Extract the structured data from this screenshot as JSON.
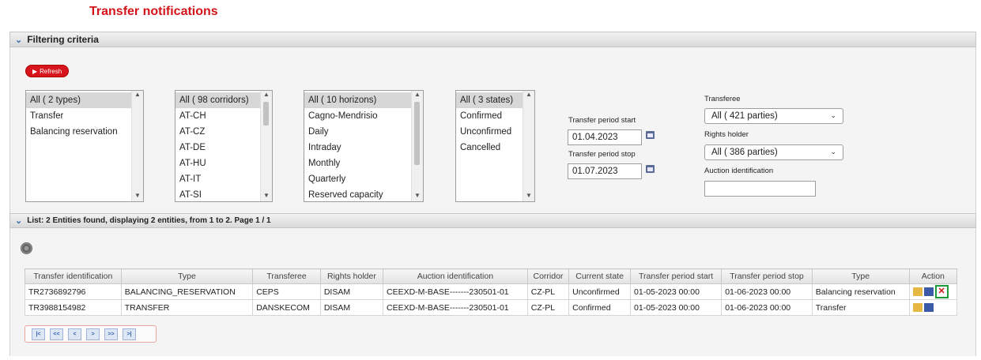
{
  "page_title": "Transfer notifications",
  "filtering": {
    "header": "Filtering criteria",
    "refresh_label": "Refresh",
    "types": [
      "All ( 2 types)",
      "Transfer",
      "Balancing reservation"
    ],
    "corridors": [
      "All ( 98 corridors)",
      "AT-CH",
      "AT-CZ",
      "AT-DE",
      "AT-HU",
      "AT-IT",
      "AT-SI"
    ],
    "horizons": [
      "All ( 10 horizons)",
      "Cagno-Mendrisio",
      "Daily",
      "Intraday",
      "Monthly",
      "Quarterly",
      "Reserved capacity"
    ],
    "states": [
      "All ( 3 states)",
      "Confirmed",
      "Unconfirmed",
      "Cancelled"
    ],
    "period_start_label": "Transfer period start",
    "period_start_value": "01.04.2023",
    "period_stop_label": "Transfer period stop",
    "period_stop_value": "01.07.2023",
    "transferee_label": "Transferee",
    "transferee_value": "All ( 421 parties)",
    "rights_holder_label": "Rights holder",
    "rights_holder_value": "All ( 386 parties)",
    "auction_label": "Auction identification",
    "auction_value": ""
  },
  "list": {
    "header": "List: 2 Entities found, displaying 2 entities, from 1 to 2. Page 1 / 1",
    "columns": [
      "Transfer identification",
      "Type",
      "Transferee",
      "Rights holder",
      "Auction identification",
      "Corridor",
      "Current state",
      "Transfer period start",
      "Transfer period stop",
      "Type",
      "Action"
    ],
    "rows": [
      [
        "TR2736892796",
        "BALANCING_RESERVATION",
        "CEPS",
        "DISAM",
        "CEEXD-M-BASE-------230501-01",
        "CZ-PL",
        "Unconfirmed",
        "01-05-2023 00:00",
        "01-06-2023 00:00",
        "Balancing reservation"
      ],
      [
        "TR3988154982",
        "TRANSFER",
        "DANSKECOM",
        "DISAM",
        "CEEXD-M-BASE-------230501-01",
        "CZ-PL",
        "Confirmed",
        "01-05-2023 00:00",
        "01-06-2023 00:00",
        "Transfer"
      ]
    ],
    "delete_symbol": "✕"
  },
  "pager": [
    "|<",
    "<<",
    "<",
    ">",
    ">>",
    ">|"
  ],
  "colors": {
    "title_red": "#d4141b",
    "refresh_red": "#d8141c",
    "highlight_green": "#1f9a3a"
  }
}
